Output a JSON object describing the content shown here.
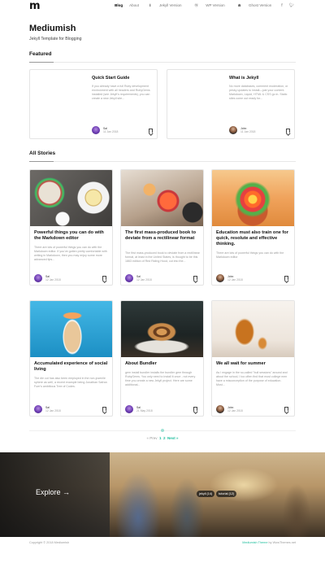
{
  "brand": {
    "logo": "m"
  },
  "nav": {
    "items": [
      {
        "label": "Blog",
        "icon": ""
      },
      {
        "label": "About",
        "icon": ""
      },
      {
        "label": "Jekyll Version",
        "icon": "download-icon"
      },
      {
        "label": "WP Version",
        "icon": "wordpress-icon"
      },
      {
        "label": "Ghost Version",
        "icon": "ghost-icon"
      }
    ],
    "social": [
      "facebook-icon",
      "twitter-icon"
    ]
  },
  "hero": {
    "title": "Mediumish",
    "subtitle": "Jekyll Template for Blogging"
  },
  "featured": {
    "heading": "Featured",
    "posts": [
      {
        "title": "Quick Start Guide",
        "excerpt": "If you already have a full Ruby development environment with all headers and RubyGems installed (see Jekyll's requirements), you can create a new Jekyll site...",
        "author": "Sal",
        "date": "11 Jan 2018"
      },
      {
        "title": "What is Jekyll",
        "excerpt": "No more databases, comment moderation, or pesky updates to install—just your content. Markdown, Liquid, HTML & CSS go in. Static sites come out ready for...",
        "author": "John",
        "date": "11 Jan 2018"
      }
    ]
  },
  "stories": {
    "heading": "All Stories",
    "posts": [
      {
        "title": "Powerful things you can do with the Markdown editor",
        "excerpt": "There are lots of powerful things you can do with the Markdown editor. If you've gotten pretty comfortable with writing in Markdown, then you may enjoy some more advanced tips...",
        "author": "Sal",
        "date": "12 Jan 2018"
      },
      {
        "title": "The first mass-produced book to deviate from a rectilinear format",
        "excerpt": "The first mass-produced book to deviate from a rectilinear format, at least in the United States, is thought to be this 1863 edition of Red Riding Hood, cut into the...",
        "author": "Sal",
        "date": "12 Jan 2018"
      },
      {
        "title": "Education must also train one for quick, resolute and effective thinking.",
        "excerpt": "There are lots of powerful things you can do with the Markdown editor",
        "author": "John",
        "date": "12 Jan 2018"
      },
      {
        "title": "Accumulated experience of social living",
        "excerpt": "The die cut has also been employed in the non-juvenile sphere as well, a recent example being Jonathan Safran Foer's ambitious Tree of Codes.",
        "author": "Sal",
        "date": "12 Jan 2018"
      },
      {
        "title": "About Bundler",
        "excerpt": "gem install bundler installs the bundler gem through RubyGems. You only need to install it once - not every time you create a new Jekyll project. Here are some additional...",
        "author": "Sal",
        "date": "21 May 2018"
      },
      {
        "title": "We all wait for summer",
        "excerpt": "As I engage in the so-called \"bull sessions\" around and about the school, I too often find that most college men have a misconception of the purpose of education. Most...",
        "author": "John",
        "date": "12 Jan 2018"
      }
    ]
  },
  "pagination": {
    "prev": "« Prev",
    "current": "1",
    "next_page": "2",
    "next": "Next »"
  },
  "banner": {
    "cta": "Explore →",
    "tags": [
      "jekyll (14)",
      "tutorial (12)"
    ]
  },
  "footer": {
    "copyright": "Copyright © 2018 Mediumish",
    "credit_brand": "Mediumish Theme",
    "credit_rest": " by WowThemes.net"
  },
  "colors": {
    "accent": "#1bbc9b"
  }
}
